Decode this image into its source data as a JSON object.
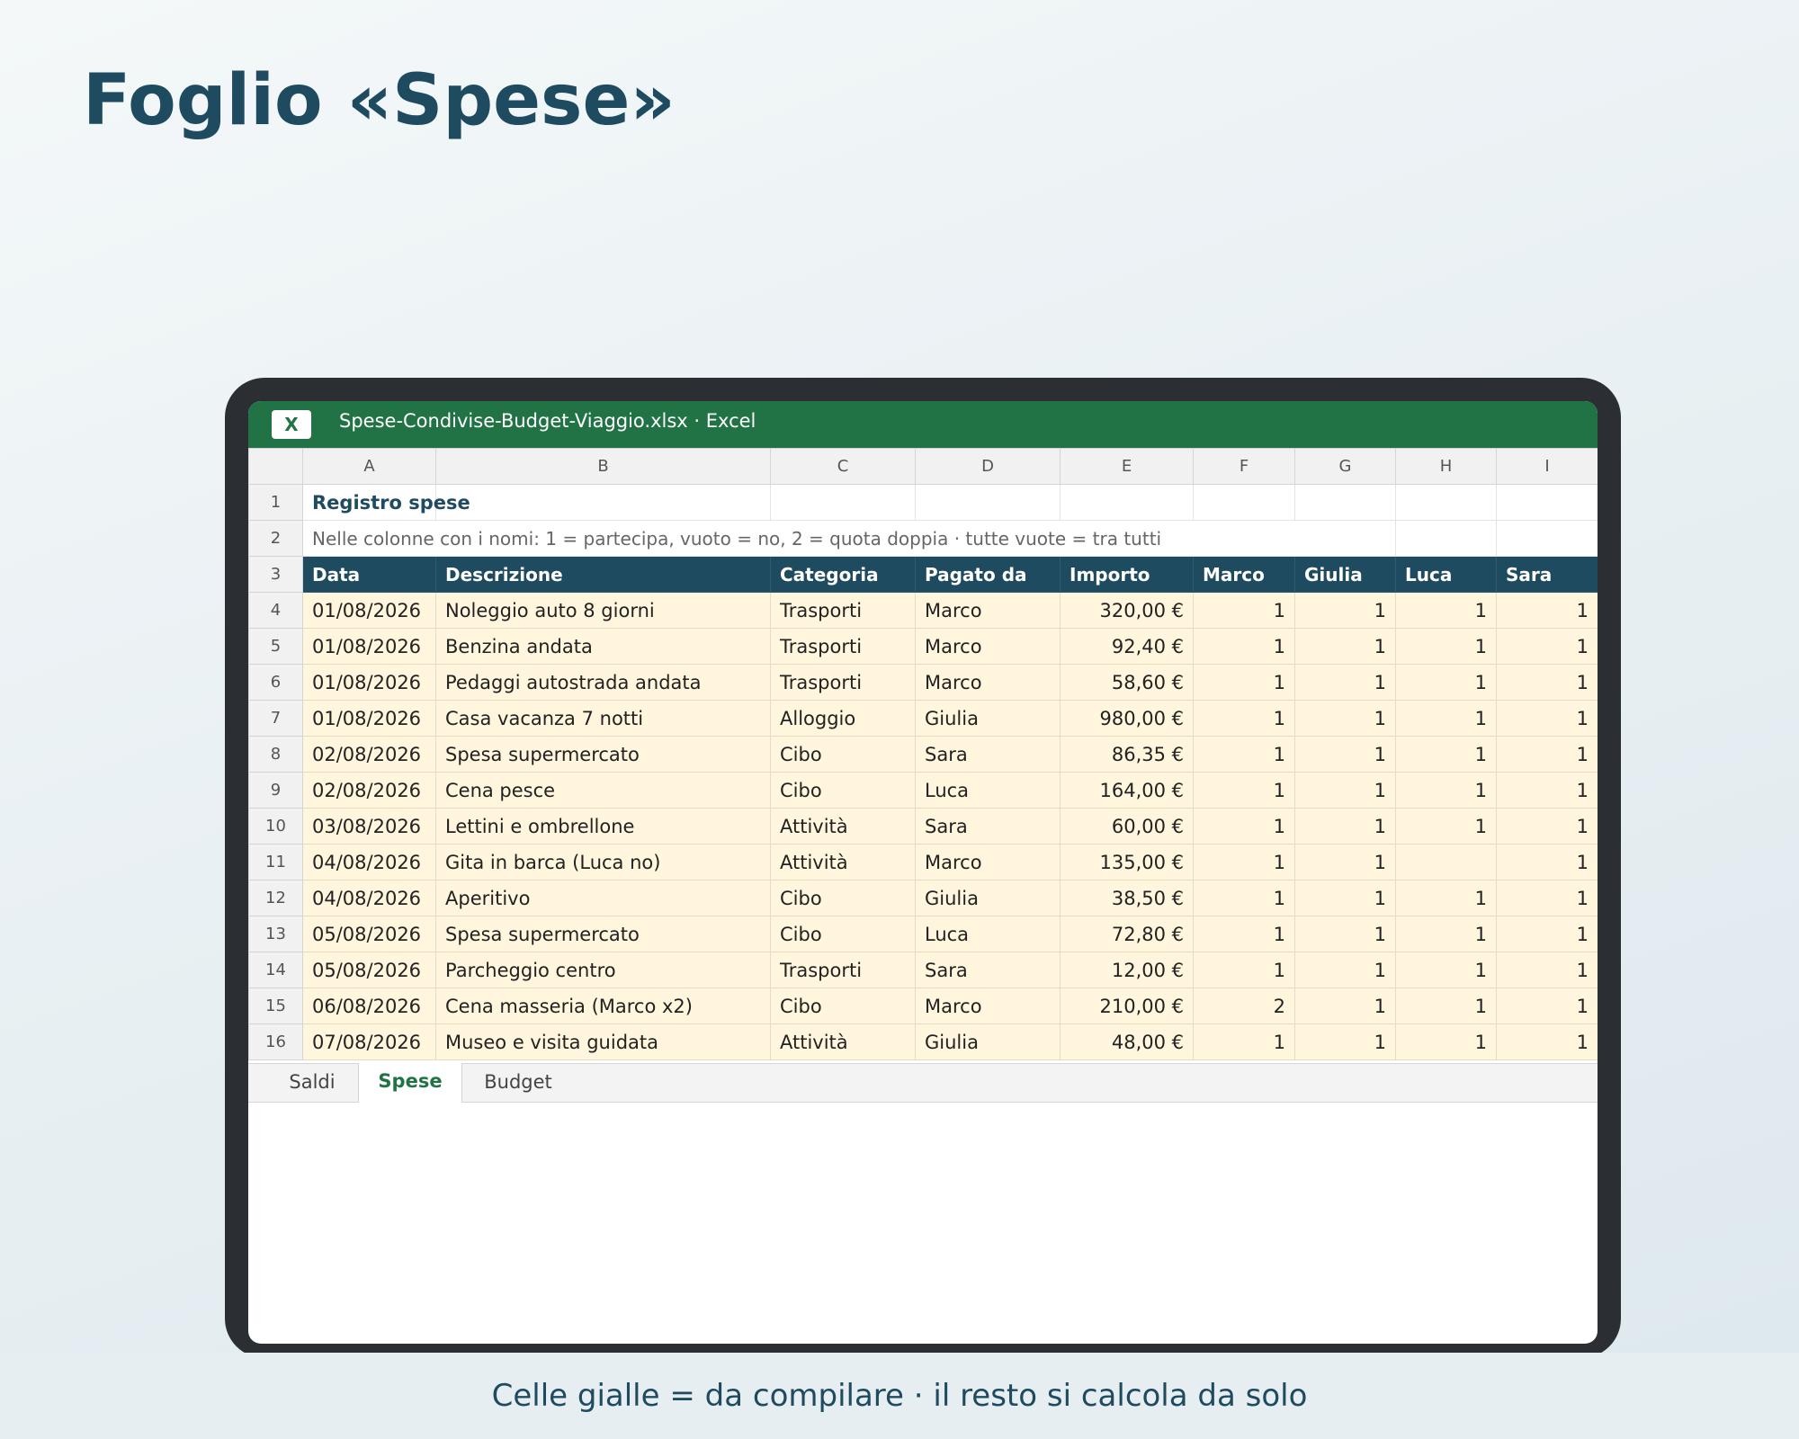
{
  "page": {
    "title": "Foglio «Spese»",
    "caption": "Celle gialle = da compilare · il resto si calcola da solo"
  },
  "window": {
    "app_icon": "X",
    "title": "Spese-Condivise-Budget-Viaggio.xlsx · Excel"
  },
  "colors": {
    "excel_green": "#217346",
    "header_navy": "#1f4b60",
    "input_yellow": "#fff6dd",
    "device_frame": "#2b2e33"
  },
  "sheet": {
    "column_letters": [
      "A",
      "B",
      "C",
      "D",
      "E",
      "F",
      "G",
      "H",
      "I"
    ],
    "title": "Registro spese",
    "note": "Nelle colonne con i nomi: 1 = partecipa, vuoto = no, 2 = quota doppia · tutte vuote = tra tutti",
    "headers": [
      "Data",
      "Descrizione",
      "Categoria",
      "Pagato da",
      "Importo",
      "Marco",
      "Giulia",
      "Luca",
      "Sara"
    ],
    "rows": [
      {
        "n": "4",
        "data": "01/08/2026",
        "descrizione": "Noleggio auto 8 giorni",
        "categoria": "Trasporti",
        "pagato_da": "Marco",
        "importo": "320,00 €",
        "marco": "1",
        "giulia": "1",
        "luca": "1",
        "sara": "1"
      },
      {
        "n": "5",
        "data": "01/08/2026",
        "descrizione": "Benzina andata",
        "categoria": "Trasporti",
        "pagato_da": "Marco",
        "importo": "92,40 €",
        "marco": "1",
        "giulia": "1",
        "luca": "1",
        "sara": "1"
      },
      {
        "n": "6",
        "data": "01/08/2026",
        "descrizione": "Pedaggi autostrada andata",
        "categoria": "Trasporti",
        "pagato_da": "Marco",
        "importo": "58,60 €",
        "marco": "1",
        "giulia": "1",
        "luca": "1",
        "sara": "1"
      },
      {
        "n": "7",
        "data": "01/08/2026",
        "descrizione": "Casa vacanza 7 notti",
        "categoria": "Alloggio",
        "pagato_da": "Giulia",
        "importo": "980,00 €",
        "marco": "1",
        "giulia": "1",
        "luca": "1",
        "sara": "1"
      },
      {
        "n": "8",
        "data": "02/08/2026",
        "descrizione": "Spesa supermercato",
        "categoria": "Cibo",
        "pagato_da": "Sara",
        "importo": "86,35 €",
        "marco": "1",
        "giulia": "1",
        "luca": "1",
        "sara": "1"
      },
      {
        "n": "9",
        "data": "02/08/2026",
        "descrizione": "Cena pesce",
        "categoria": "Cibo",
        "pagato_da": "Luca",
        "importo": "164,00 €",
        "marco": "1",
        "giulia": "1",
        "luca": "1",
        "sara": "1"
      },
      {
        "n": "10",
        "data": "03/08/2026",
        "descrizione": "Lettini e ombrellone",
        "categoria": "Attività",
        "pagato_da": "Sara",
        "importo": "60,00 €",
        "marco": "1",
        "giulia": "1",
        "luca": "1",
        "sara": "1"
      },
      {
        "n": "11",
        "data": "04/08/2026",
        "descrizione": "Gita in barca (Luca no)",
        "categoria": "Attività",
        "pagato_da": "Marco",
        "importo": "135,00 €",
        "marco": "1",
        "giulia": "1",
        "luca": "",
        "sara": "1"
      },
      {
        "n": "12",
        "data": "04/08/2026",
        "descrizione": "Aperitivo",
        "categoria": "Cibo",
        "pagato_da": "Giulia",
        "importo": "38,50 €",
        "marco": "1",
        "giulia": "1",
        "luca": "1",
        "sara": "1"
      },
      {
        "n": "13",
        "data": "05/08/2026",
        "descrizione": "Spesa supermercato",
        "categoria": "Cibo",
        "pagato_da": "Luca",
        "importo": "72,80 €",
        "marco": "1",
        "giulia": "1",
        "luca": "1",
        "sara": "1"
      },
      {
        "n": "14",
        "data": "05/08/2026",
        "descrizione": "Parcheggio centro",
        "categoria": "Trasporti",
        "pagato_da": "Sara",
        "importo": "12,00 €",
        "marco": "1",
        "giulia": "1",
        "luca": "1",
        "sara": "1"
      },
      {
        "n": "15",
        "data": "06/08/2026",
        "descrizione": "Cena masseria (Marco x2)",
        "categoria": "Cibo",
        "pagato_da": "Marco",
        "importo": "210,00 €",
        "marco": "2",
        "giulia": "1",
        "luca": "1",
        "sara": "1"
      },
      {
        "n": "16",
        "data": "07/08/2026",
        "descrizione": "Museo e visita guidata",
        "categoria": "Attività",
        "pagato_da": "Giulia",
        "importo": "48,00 €",
        "marco": "1",
        "giulia": "1",
        "luca": "1",
        "sara": "1"
      }
    ]
  },
  "tabs": [
    {
      "label": "Saldi",
      "active": false
    },
    {
      "label": "Spese",
      "active": true
    },
    {
      "label": "Budget",
      "active": false
    }
  ]
}
